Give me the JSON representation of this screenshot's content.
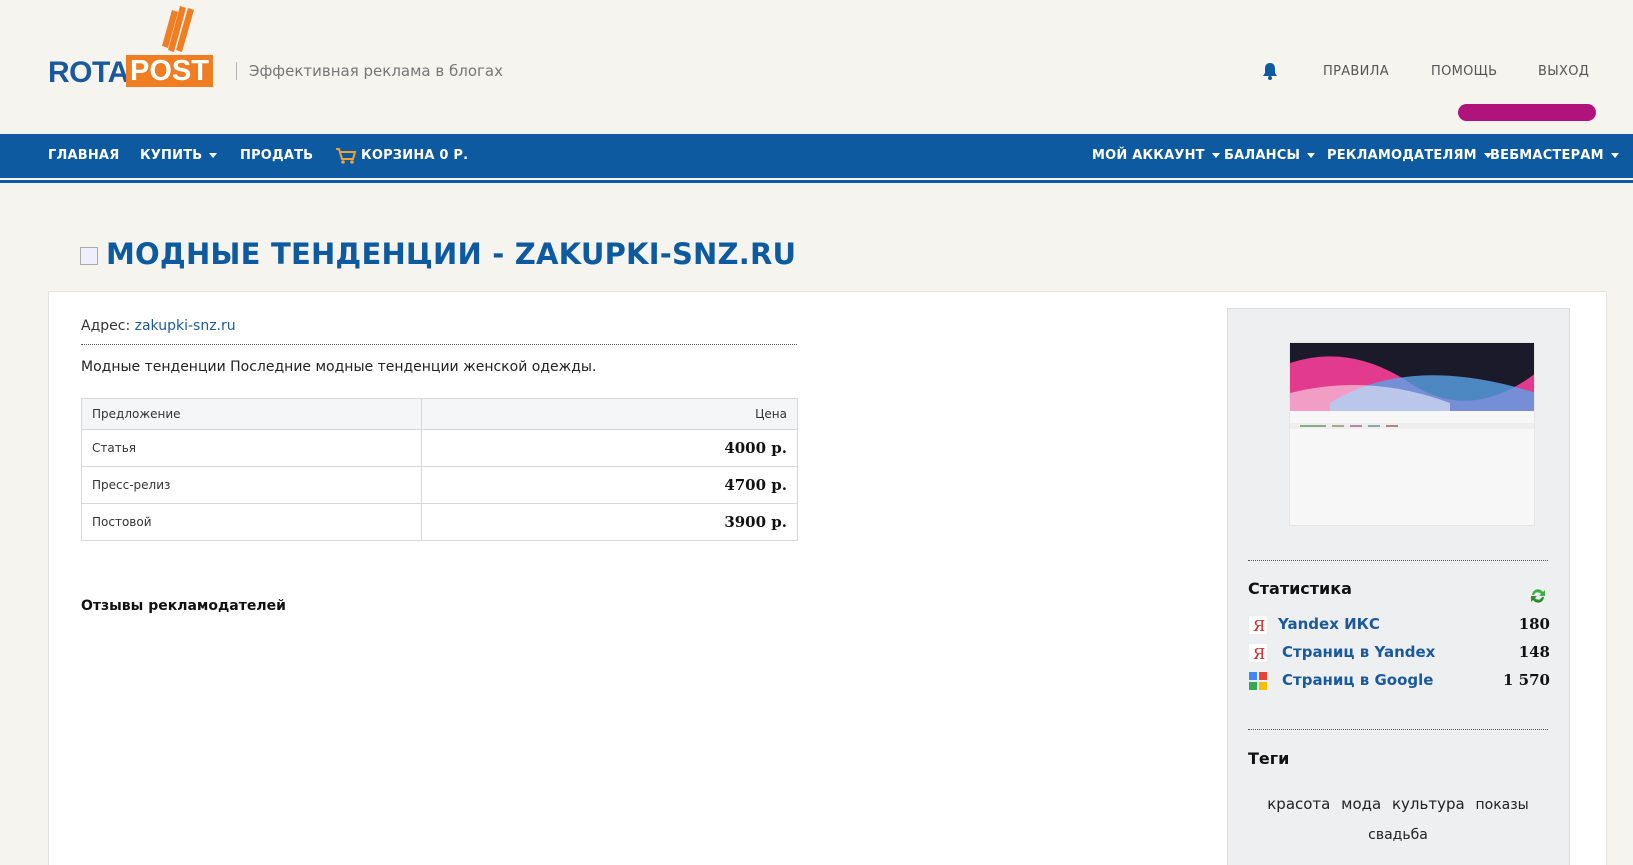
{
  "header": {
    "logo_rota": "ROTA",
    "logo_post": "POST",
    "tagline": "Эффективная реклама в блогах",
    "links": [
      "ПРАВИЛА",
      "ПОМОЩЬ",
      "ВЫХОД"
    ]
  },
  "nav": {
    "left": [
      {
        "label": "ГЛАВНАЯ"
      },
      {
        "label": "КУПИТЬ"
      },
      {
        "label": "ПРОДАТЬ"
      },
      {
        "label": "КОРЗИНА 0 Р."
      }
    ],
    "right": [
      {
        "label": "МОЙ АККАУНТ"
      },
      {
        "label": "БАЛАНСЫ"
      },
      {
        "label": "РЕКЛАМОДАТЕЛЯМ"
      },
      {
        "label": "ВЕБМАСТЕРАМ"
      }
    ]
  },
  "page": {
    "title": "МОДНЫЕ ТЕНДЕНЦИИ - ZAKUPKI-SNZ.RU",
    "address_label": "Адрес:",
    "address_link": "zakupki-snz.ru",
    "description": "Модные тенденции Последние модные тенденции женской одежды.",
    "table": {
      "col_offer": "Предложение",
      "col_price": "Цена",
      "rows": [
        {
          "name": "Статья",
          "price": "4000 р."
        },
        {
          "name": "Пресс-релиз",
          "price": "4700 р."
        },
        {
          "name": "Постовой",
          "price": "3900 р."
        }
      ]
    },
    "reviews_heading": "Отзывы рекламодателей"
  },
  "sidebar": {
    "stats_heading": "Статистика",
    "stats": [
      {
        "label": "Yandex ИКС",
        "value": "180",
        "icon": "yandex-icon"
      },
      {
        "label": "Страниц в Yandex",
        "value": "148",
        "icon": "yandex-icon"
      },
      {
        "label": "Страниц в Google",
        "value": "1 570",
        "icon": "google-icon"
      }
    ],
    "tags_heading": "Теги",
    "tags": [
      "красота",
      "мода",
      "культура",
      "показы",
      "свадьба"
    ]
  },
  "colors": {
    "brand_blue": "#0e5aa0",
    "brand_orange": "#f07d22",
    "accent_pink": "#b0137c"
  }
}
